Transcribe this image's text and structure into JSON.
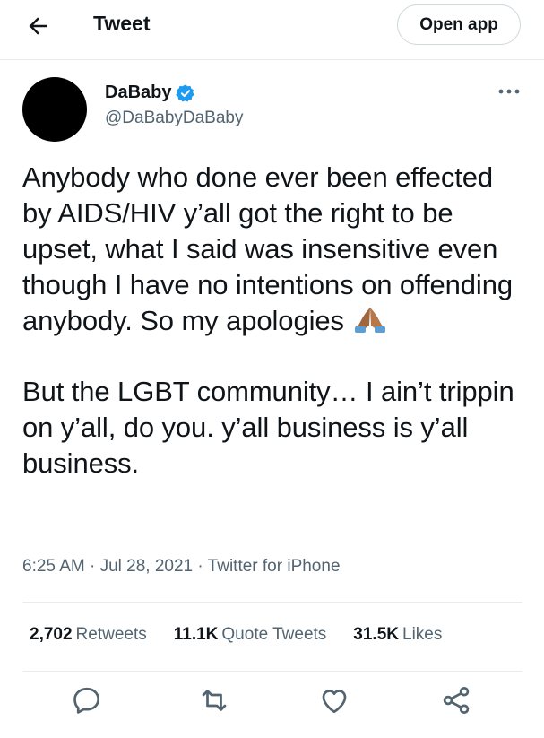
{
  "header": {
    "title": "Tweet",
    "open_app_label": "Open app"
  },
  "tweet": {
    "author_name": "DaBaby",
    "author_handle": "@DaBabyDaBaby",
    "paragraph_1": "Anybody who done ever been effected by AIDS/HIV y’all got the right to be upset, what I said was insensitive even though I have no intentions on offending anybody. So my apologies",
    "emoji": "folded-hands-emoji",
    "paragraph_2": "But the LGBT community… I ain’t trippin on y’all, do you. y’all business is y’all business.",
    "timestamp": "6:25 AM · Jul 28, 2021 · Twitter for iPhone"
  },
  "stats": {
    "retweets_count": "2,702",
    "retweets_label": "Retweets",
    "quotes_count": "11.1K",
    "quotes_label": "Quote Tweets",
    "likes_count": "31.5K",
    "likes_label": "Likes"
  },
  "colors": {
    "accent": "#1d9bf0",
    "text": "#0f1419",
    "muted": "#536471",
    "divider": "#e6ecf0"
  },
  "icons": [
    "back-arrow-icon",
    "verified-badge-icon",
    "more-options-icon",
    "reply-icon",
    "retweet-icon",
    "like-icon",
    "share-icon"
  ]
}
